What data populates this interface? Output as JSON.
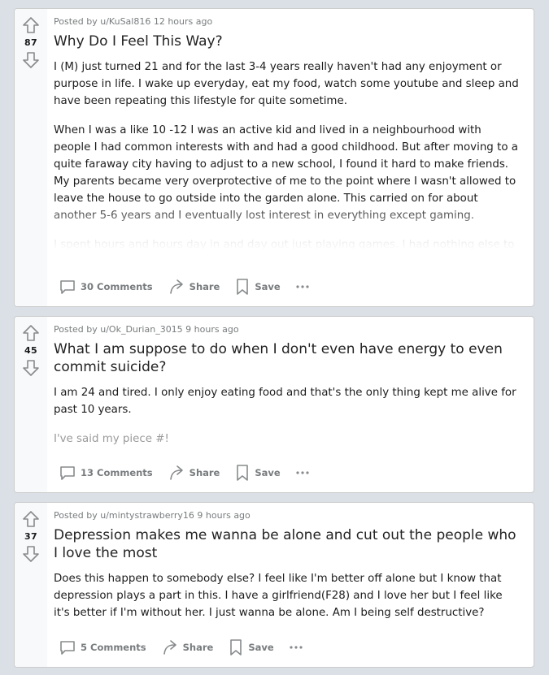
{
  "posts": [
    {
      "score": "87",
      "posted_by": "Posted by u/KuSal816 12 hours ago",
      "title": "Why Do I Feel This Way?",
      "paragraphs": [
        "I (M) just turned 21 and for the last 3-4 years really haven't had any enjoyment or purpose in life. I wake up everyday, eat my food, watch some youtube and sleep and have been repeating this lifestyle for quite sometime.",
        "When I was a like 10 -12 I was an active kid and lived in a neighbourhood with people I had common interests with and had a good childhood. But after moving to a quite faraway city having to adjust to a new school, I found it hard to make friends. My parents became very overprotective of me to the point where I wasn't allowed to leave the house to go outside into the garden alone. This carried on for about another 5-6 years and I eventually lost interest in everything except gaming.",
        "I spent hours and hours day in and day out just playing games. I had nothing else to do because I didn't have many friends and I didn't have any freedom. I did my A/L's and"
      ],
      "comments_label": "30 Comments",
      "share_label": "Share",
      "save_label": "Save"
    },
    {
      "score": "45",
      "posted_by": "Posted by u/Ok_Durian_3015 9 hours ago",
      "title": "What I am suppose to do when I don't even have energy to even commit suicide?",
      "paragraphs": [
        "I am 24 and tired. I only enjoy eating food and that's the only thing kept me alive for past 10 years."
      ],
      "signature": "I've said my piece #!",
      "comments_label": "13 Comments",
      "share_label": "Share",
      "save_label": "Save"
    },
    {
      "score": "37",
      "posted_by": "Posted by u/mintystrawberry16 9 hours ago",
      "title": "Depression makes me wanna be alone and cut out the people who I love the most",
      "paragraphs": [
        "Does this happen to somebody else? I feel like I'm better off alone but I know that depression plays a part in this. I have a girlfriend(F28) and I love her but I feel like it's better if I'm without her. I just wanna be alone. Am I being self destructive?"
      ],
      "comments_label": "5 Comments",
      "share_label": "Share",
      "save_label": "Save"
    }
  ],
  "icons": {
    "upvote": "upvote-arrow-icon",
    "downvote": "downvote-arrow-icon",
    "comment": "comment-bubble-icon",
    "share": "share-arrow-icon",
    "save": "bookmark-icon",
    "more": "more-dots-icon"
  },
  "colors": {
    "page_background": "#dae0e6",
    "card_background": "#ffffff",
    "vote_column": "#f8f9fa",
    "meta_text": "#787c7e"
  }
}
